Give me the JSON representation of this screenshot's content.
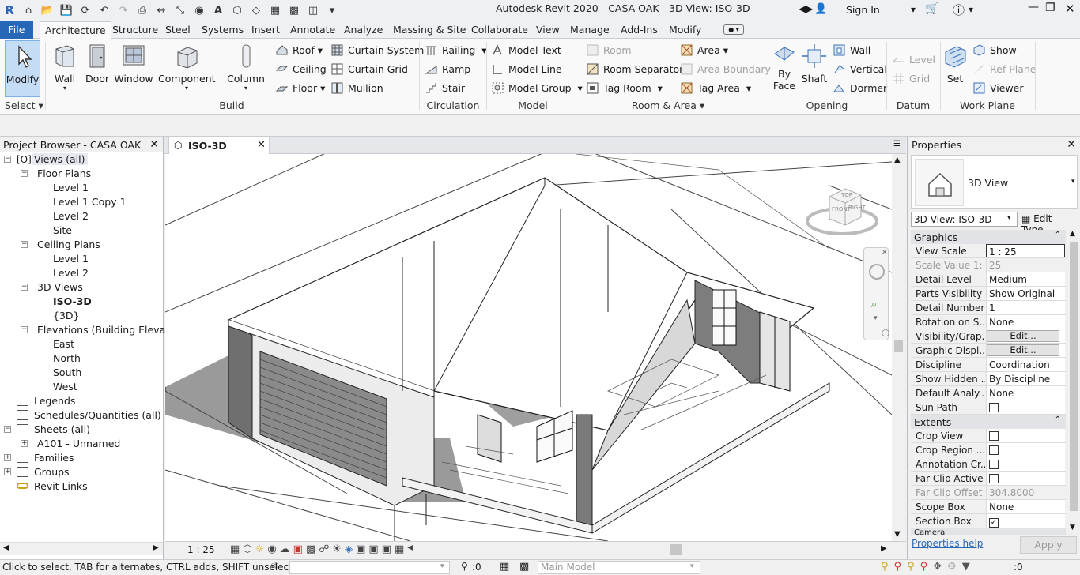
{
  "app": {
    "title": "Autodesk Revit 2020 - CASA OAK - 3D View: ISO-3D",
    "sign_in": "Sign In"
  },
  "tabs": [
    "File",
    "Architecture",
    "Structure",
    "Steel",
    "Systems",
    "Insert",
    "Annotate",
    "Analyze",
    "Massing & Site",
    "Collaborate",
    "View",
    "Manage",
    "Add-Ins",
    "Modify"
  ],
  "ribbon": {
    "select": {
      "modify": "Modify",
      "select": "Select"
    },
    "build": {
      "wall": "Wall",
      "door": "Door",
      "window": "Window",
      "component": "Component",
      "column": "Column",
      "roof": "Roof",
      "ceiling": "Ceiling",
      "floor": "Floor",
      "curtain_system": "Curtain System",
      "curtain_grid": "Curtain Grid",
      "mullion": "Mullion",
      "label": "Build"
    },
    "circulation": {
      "railing": "Railing",
      "ramp": "Ramp",
      "stair": "Stair",
      "label": "Circulation"
    },
    "model": {
      "model_text": "Model  Text",
      "model_line": "Model  Line",
      "model_group": "Model  Group",
      "label": "Model"
    },
    "room_area": {
      "room": "Room",
      "room_separator": "Room  Separator",
      "tag_room": "Tag  Room",
      "area": "Area",
      "area_boundary": "Area  Boundary",
      "tag_area": "Tag  Area",
      "label": "Room & Area"
    },
    "opening": {
      "by_face": "By\nFace",
      "by_face_1": "By",
      "by_face_2": "Face",
      "shaft": "Shaft",
      "wall": "Wall",
      "vertical": "Vertical",
      "dormer": "Dormer",
      "label": "Opening"
    },
    "datum": {
      "level": "Level",
      "grid": "Grid",
      "label": "Datum"
    },
    "work_plane": {
      "set": "Set",
      "show": "Show",
      "ref_plane": "Ref  Plane",
      "viewer": "Viewer",
      "label": "Work Plane"
    }
  },
  "project_browser": {
    "title": "Project Browser - CASA OAK",
    "items": [
      {
        "label": "Views (all)"
      },
      {
        "label": "Floor Plans"
      },
      {
        "label": "Level 1"
      },
      {
        "label": "Level 1 Copy 1"
      },
      {
        "label": "Level 2"
      },
      {
        "label": "Site"
      },
      {
        "label": "Ceiling Plans"
      },
      {
        "label": "Level 1"
      },
      {
        "label": "Level 2"
      },
      {
        "label": "3D Views"
      },
      {
        "label": "ISO-3D"
      },
      {
        "label": "{3D}"
      },
      {
        "label": "Elevations (Building Elevation"
      },
      {
        "label": "East"
      },
      {
        "label": "North"
      },
      {
        "label": "South"
      },
      {
        "label": "West"
      },
      {
        "label": "Legends"
      },
      {
        "label": "Schedules/Quantities (all)"
      },
      {
        "label": "Sheets (all)"
      },
      {
        "label": "A101 - Unnamed"
      },
      {
        "label": "Families"
      },
      {
        "label": "Groups"
      },
      {
        "label": "Revit Links"
      }
    ]
  },
  "view": {
    "tab": "ISO-3D",
    "scale": "1 : 25"
  },
  "properties": {
    "title": "Properties",
    "type_name": "3D View",
    "selector": "3D View: ISO-3D",
    "edit_type": "Edit Type",
    "sections": {
      "graphics": "Graphics",
      "extents": "Extents",
      "camera": "Camera"
    },
    "rows": [
      {
        "k": "View Scale",
        "v": "1 : 25"
      },
      {
        "k": "Scale Value    1:",
        "v": "25"
      },
      {
        "k": "Detail Level",
        "v": "Medium"
      },
      {
        "k": "Parts Visibility",
        "v": "Show Original"
      },
      {
        "k": "Detail Number",
        "v": "1"
      },
      {
        "k": "Rotation on S...",
        "v": "None"
      },
      {
        "k": "Visibility/Grap...",
        "v": "Edit..."
      },
      {
        "k": "Graphic Displ...",
        "v": "Edit..."
      },
      {
        "k": "Discipline",
        "v": "Coordination"
      },
      {
        "k": "Show Hidden ...",
        "v": "By Discipline"
      },
      {
        "k": "Default Analy...",
        "v": "None"
      },
      {
        "k": "Sun Path",
        "v": ""
      },
      {
        "k": "Crop View",
        "v": ""
      },
      {
        "k": "Crop Region ...",
        "v": ""
      },
      {
        "k": "Annotation Cr...",
        "v": ""
      },
      {
        "k": "Far Clip Active",
        "v": ""
      },
      {
        "k": "Far Clip Offset",
        "v": "304.8000"
      },
      {
        "k": "Scope Box",
        "v": "None"
      },
      {
        "k": "Section Box",
        "v": ""
      }
    ],
    "help": "Properties help",
    "apply": "Apply"
  },
  "status": {
    "message": "Click to select, TAB for alternates, CTRL adds, SHIFT unselects.",
    "count": ":0",
    "workset": "Main Model",
    "filter_count": ":0"
  },
  "viewcube": {
    "front": "FRONT",
    "right": "RIGHT",
    "top": "TOP"
  },
  "colors": {
    "accent": "#2767b8",
    "selected_tool": "#c5dcf5",
    "shadow": "#9a9a9a"
  }
}
